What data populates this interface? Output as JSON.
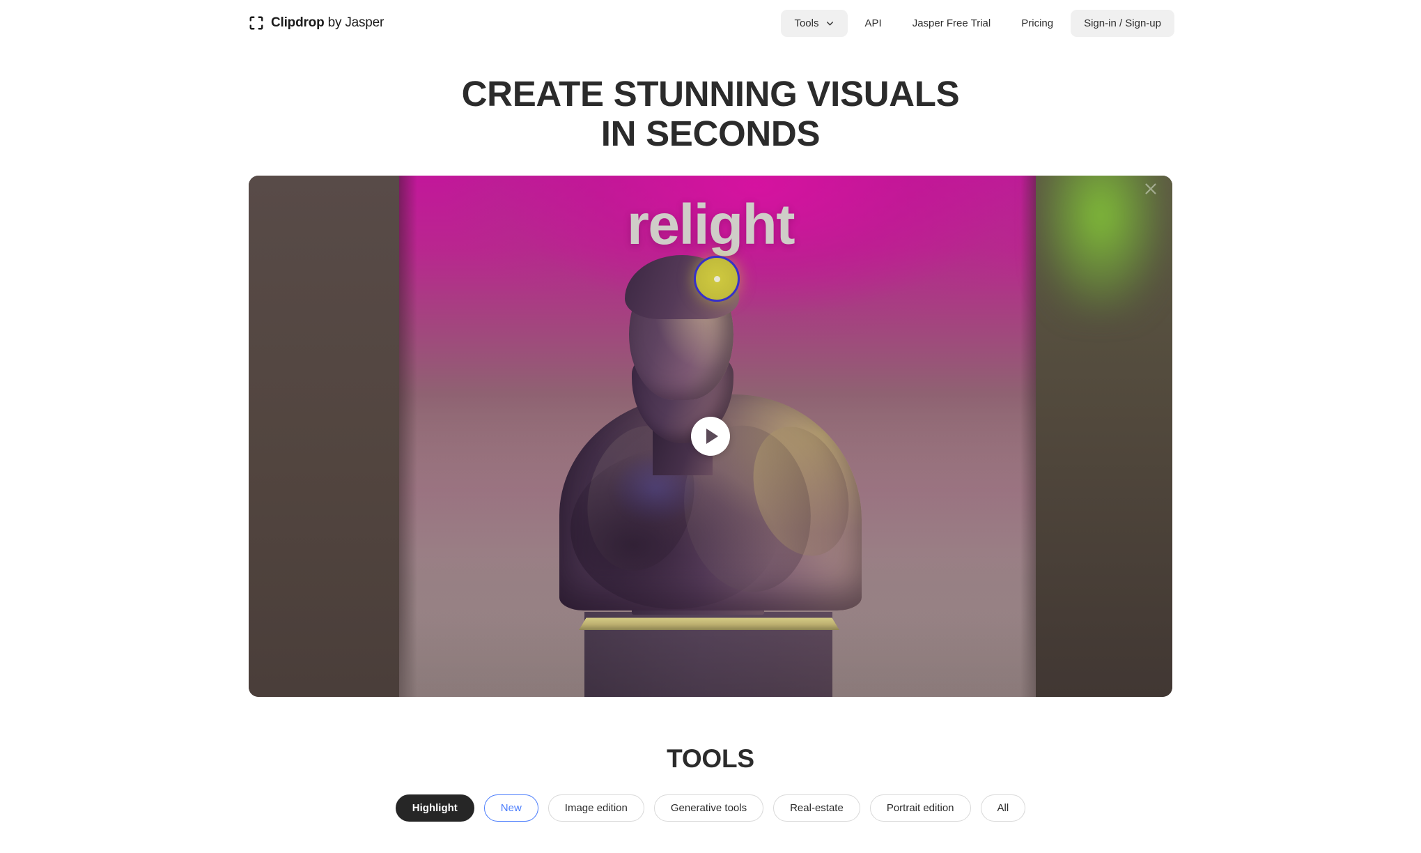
{
  "brand": {
    "icon": "crop-frame-icon",
    "name_bold": "Clipdrop",
    "name_light": " by Jasper"
  },
  "nav": {
    "items": [
      {
        "label": "Tools",
        "icon": "chevron-down-icon",
        "style": "filled",
        "has_chevron": true
      },
      {
        "label": "API",
        "style": "plain",
        "has_chevron": false
      },
      {
        "label": "Jasper Free Trial",
        "style": "plain",
        "has_chevron": false
      },
      {
        "label": "Pricing",
        "style": "plain",
        "has_chevron": false
      },
      {
        "label": "Sign-in / Sign-up",
        "style": "filled",
        "has_chevron": false
      }
    ]
  },
  "hero": {
    "headline_line1": "CREATE STUNNING VISUALS",
    "headline_line2": "IN SECONDS",
    "video": {
      "overlay_word": "relight",
      "play_icon": "play-icon",
      "close_icon": "close-icon",
      "light_marker_icon": "light-source-handle",
      "colors": {
        "magenta": "#c2179a",
        "green_glow": "#83c437",
        "marker_fill": "#cfc93f",
        "marker_ring": "#3731c8",
        "wall_left": "#584b48"
      }
    }
  },
  "tools": {
    "title": "TOOLS",
    "filters": [
      {
        "label": "Highlight",
        "state": "active"
      },
      {
        "label": "New",
        "state": "accent"
      },
      {
        "label": "Image edition",
        "state": "default"
      },
      {
        "label": "Generative tools",
        "state": "default"
      },
      {
        "label": "Real-estate",
        "state": "default"
      },
      {
        "label": "Portrait edition",
        "state": "default"
      },
      {
        "label": "All",
        "state": "default"
      }
    ],
    "accent_color": "#4b7dfc",
    "active_color": "#262626"
  }
}
